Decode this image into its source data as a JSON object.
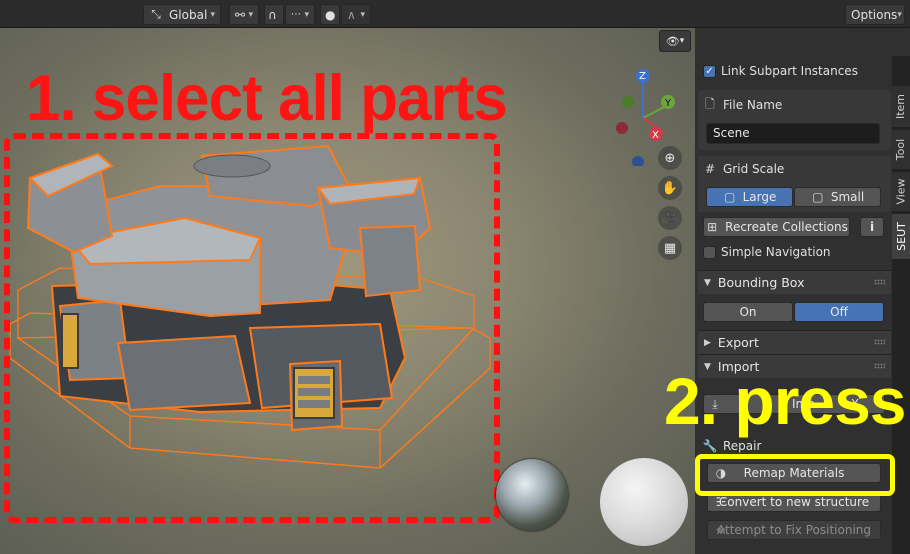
{
  "header": {
    "transform_space": "Global",
    "options_label": "Options",
    "icons": [
      "transform-pivot-icon",
      "snap-icon",
      "snap-increment-icon",
      "proportional-edit-icon",
      "falloff-icon"
    ]
  },
  "viewport": {
    "annotation_step1": "1. select all parts",
    "annotation_step2": "2. press",
    "gizmo": {
      "z": "Z",
      "y": "Y",
      "x": "X"
    },
    "nav_icons": [
      "zoom-icon",
      "hand-pan-icon",
      "camera-icon",
      "grid-perspective-icon"
    ]
  },
  "sidebar": {
    "tabs": [
      "Item",
      "Tool",
      "View",
      "SEUT"
    ],
    "active_tab": "SEUT",
    "link_subpart_instances": {
      "label": "Link Subpart Instances",
      "checked": true
    },
    "file_name": {
      "label": "File Name",
      "value": "Scene"
    },
    "grid_scale": {
      "label": "Grid Scale",
      "large": "Large",
      "small": "Small",
      "selected": "Large"
    },
    "recreate_collections": "Recreate Collections",
    "info_glyph": "i",
    "simple_navigation": {
      "label": "Simple Navigation",
      "checked": false
    },
    "bounding_box": {
      "title": "Bounding Box",
      "on": "On",
      "off": "Off",
      "selected": "Off"
    },
    "export": {
      "title": "Export"
    },
    "import": {
      "title": "Import",
      "import_label_partial": "Imp",
      "import_label_tail": "X"
    },
    "repair": {
      "label": "Repair"
    },
    "remap_materials": "Remap Materials",
    "convert_structure": "Convert to new structure",
    "fix_positioning": "Attempt to Fix Positioning"
  },
  "colors": {
    "accent_blue": "#4772b3",
    "annotation_red": "#ff1414",
    "annotation_yellow": "#ffff00",
    "outline_orange": "#ff7a1a"
  }
}
